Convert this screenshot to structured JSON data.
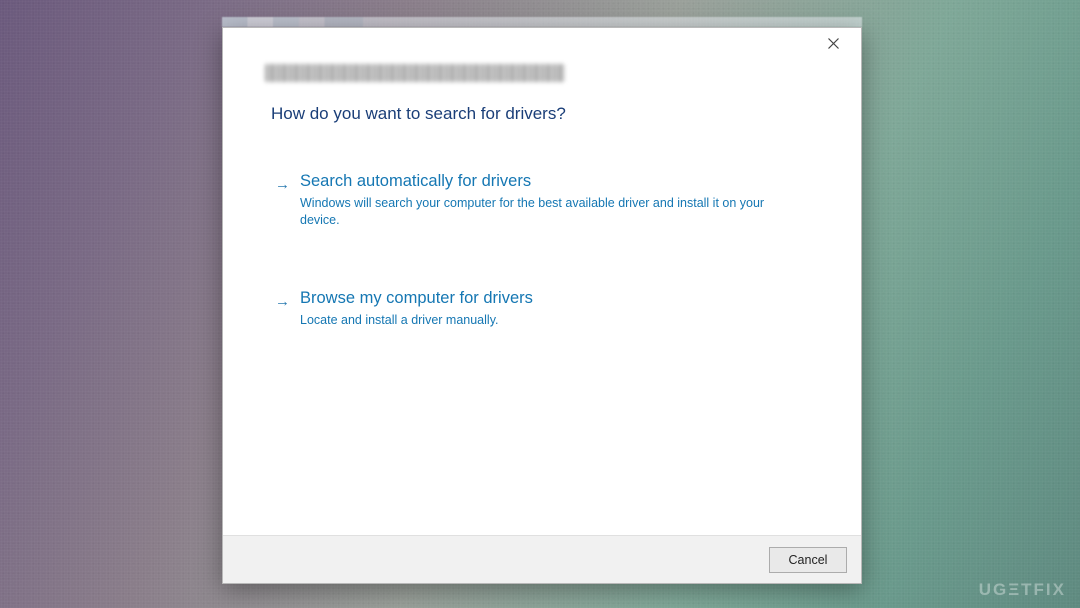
{
  "dialog": {
    "heading": "How do you want to search for drivers?",
    "options": [
      {
        "title": "Search automatically for drivers",
        "description": "Windows will search your computer for the best available driver and install it on your device."
      },
      {
        "title": "Browse my computer for drivers",
        "description": "Locate and install a driver manually."
      }
    ],
    "cancel_label": "Cancel"
  },
  "watermark": "UGΞTFIX"
}
